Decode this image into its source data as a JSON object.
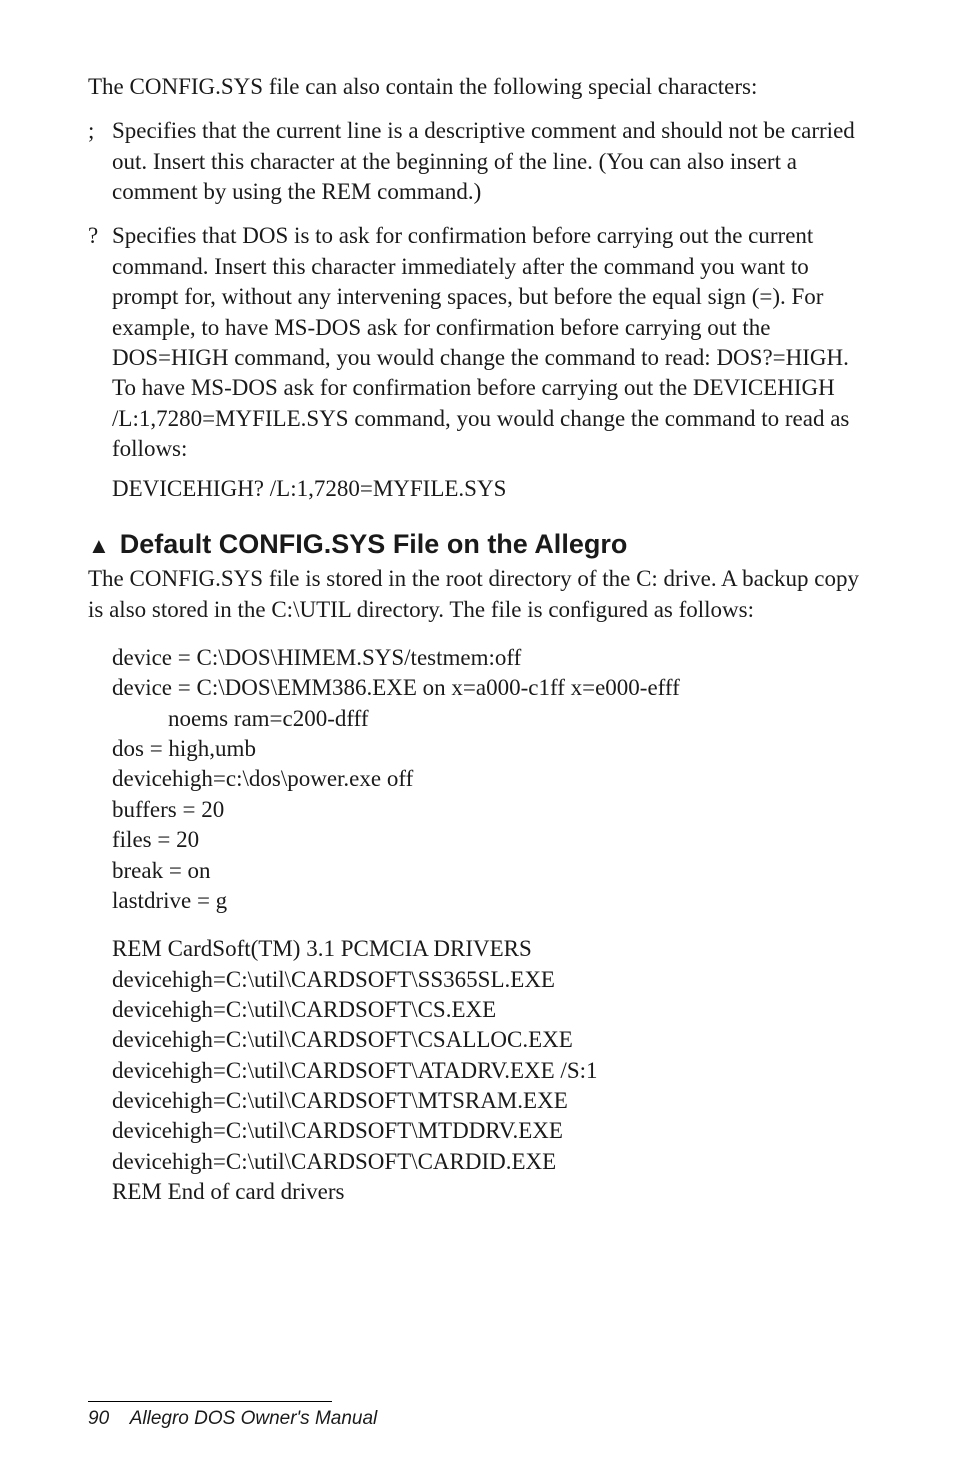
{
  "intro": "The CONFIG.SYS file can also contain the following special characters:",
  "items": [
    {
      "term": ";",
      "def": "Specifies that the current line is a descriptive comment and should not be carried out. Insert this character at the beginning of the line. (You can also insert a comment by using  the REM command.)"
    },
    {
      "term": "?",
      "def": "Specifies that DOS is to ask for confirmation before carrying out the current command. Insert this character  immediately after the command you want to prompt for, without any intervening spaces, but before the equal sign (=). For example, to have MS-DOS ask for confirmation before carrying out the DOS=HIGH command, you would change the command to read:  DOS?=HIGH. To have MS-DOS ask for confirmation before  carrying out the DEVICEHIGH /L:1,7280=MYFILE.SYS command, you would change the command to read as follows:",
      "def2": "DEVICEHIGH? /L:1,7280=MYFILE.SYS"
    }
  ],
  "heading": {
    "triangle": "▲",
    "text": "Default CONFIG.SYS File on the Allegro"
  },
  "heading_body": "The CONFIG.SYS file is stored in the root directory of the C: drive. A backup copy is also stored in the C:\\UTIL directory. The file is configured as follows:",
  "code1": {
    "l1": "device = C:\\DOS\\HIMEM.SYS/testmem:off",
    "l2": "device = C:\\DOS\\EMM386.EXE on x=a000-c1ff x=e000-efff",
    "l2b": "noems ram=c200-dfff",
    "l3": "dos = high,umb",
    "l4": "devicehigh=c:\\dos\\power.exe off",
    "l5": "buffers = 20",
    "l6": "files = 20",
    "l7": "break = on",
    "l8": "lastdrive = g"
  },
  "code2": {
    "l1": "REM CardSoft(TM) 3.1 PCMCIA DRIVERS",
    "l2": "devicehigh=C:\\util\\CARDSOFT\\SS365SL.EXE",
    "l3": "devicehigh=C:\\util\\CARDSOFT\\CS.EXE",
    "l4": "devicehigh=C:\\util\\CARDSOFT\\CSALLOC.EXE",
    "l5": "devicehigh=C:\\util\\CARDSOFT\\ATADRV.EXE /S:1",
    "l6": "devicehigh=C:\\util\\CARDSOFT\\MTSRAM.EXE",
    "l7": "devicehigh=C:\\util\\CARDSOFT\\MTDDRV.EXE",
    "l8": "devicehigh=C:\\util\\CARDSOFT\\CARDID.EXE",
    "l9": "REM End of card drivers"
  },
  "footer": {
    "page": "90",
    "title": "Allegro DOS Owner's Manual"
  }
}
